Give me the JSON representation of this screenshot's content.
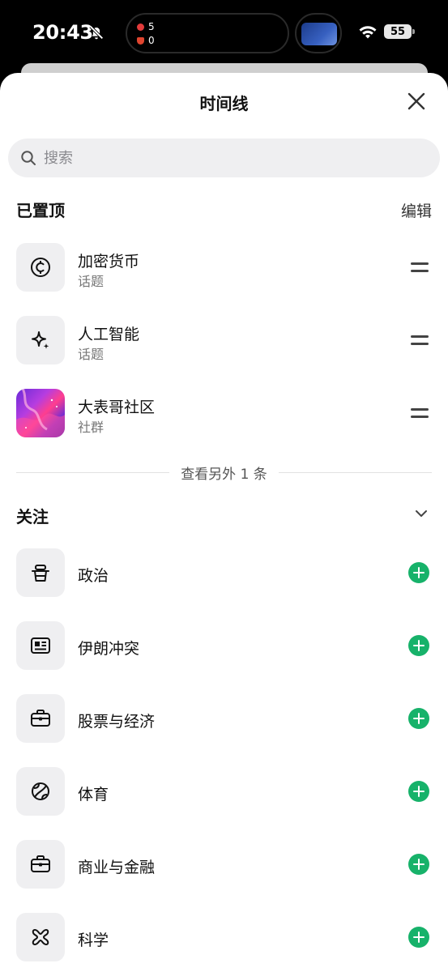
{
  "status_bar": {
    "time": "20:43",
    "island_counts": [
      "5",
      "0"
    ],
    "battery": "55"
  },
  "sheet": {
    "title": "时间线",
    "search_placeholder": "搜索"
  },
  "pinned": {
    "title": "已置顶",
    "edit_label": "编辑",
    "items": [
      {
        "name": "加密货币",
        "type": "话题",
        "icon": "crypto-coin-icon"
      },
      {
        "name": "人工智能",
        "type": "话题",
        "icon": "sparkle-icon"
      },
      {
        "name": "大表哥社区",
        "type": "社群",
        "icon": "community-avatar"
      }
    ],
    "more_label": "查看另外 1 条"
  },
  "following": {
    "title": "关注",
    "items": [
      {
        "name": "政治",
        "icon": "podium-icon"
      },
      {
        "name": "伊朗冲突",
        "icon": "newspaper-icon"
      },
      {
        "name": "股票与经济",
        "icon": "briefcase-icon"
      },
      {
        "name": "体育",
        "icon": "ball-icon"
      },
      {
        "name": "商业与金融",
        "icon": "briefcase-icon"
      },
      {
        "name": "科学",
        "icon": "atom-icon"
      }
    ]
  },
  "colors": {
    "accent_green": "#17b26a",
    "tile_bg": "#efeff1"
  }
}
